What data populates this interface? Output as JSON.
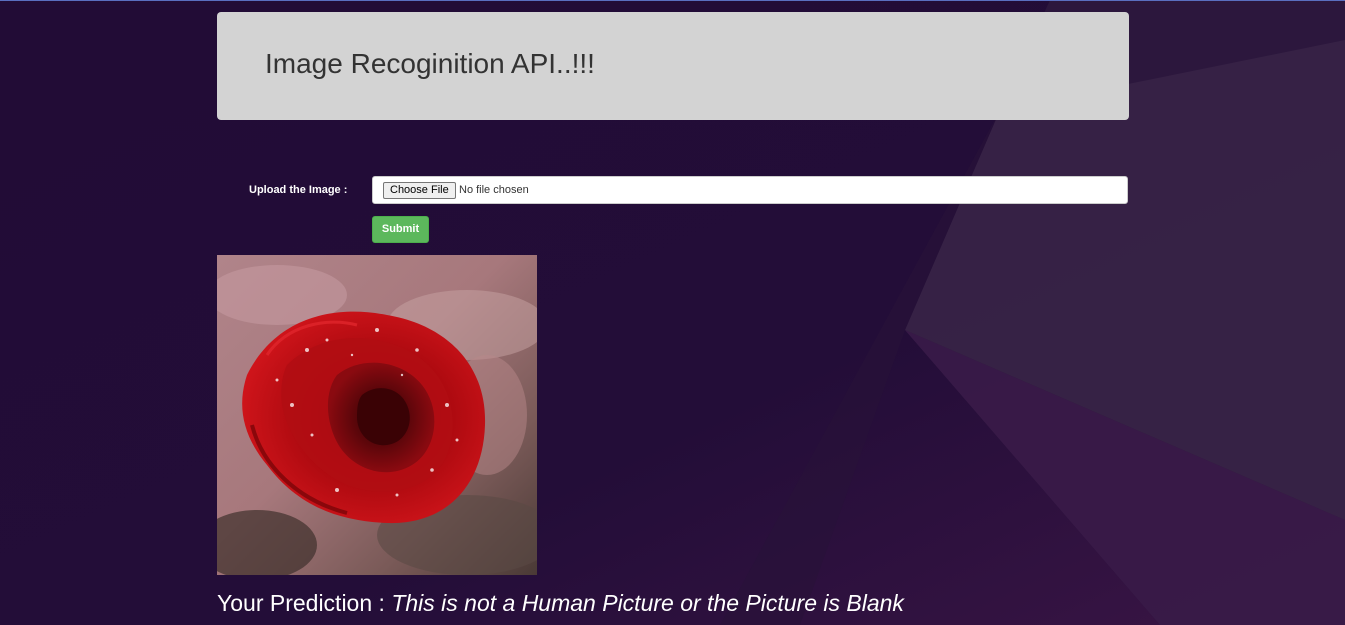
{
  "header": {
    "title": "Image Recoginition API..!!!"
  },
  "form": {
    "upload_label": "Upload the Image :",
    "choose_file_label": "Choose File",
    "no_file_text": "No file chosen",
    "submit_label": "Submit"
  },
  "preview": {
    "subject": "red rose with water droplets"
  },
  "result": {
    "prefix": "Your Prediction :",
    "text": "This is not a Human Picture or the Picture is Blank"
  },
  "colors": {
    "background": "#230d38",
    "jumbotron": "#d3d3d3",
    "submit": "#5cb85c"
  }
}
